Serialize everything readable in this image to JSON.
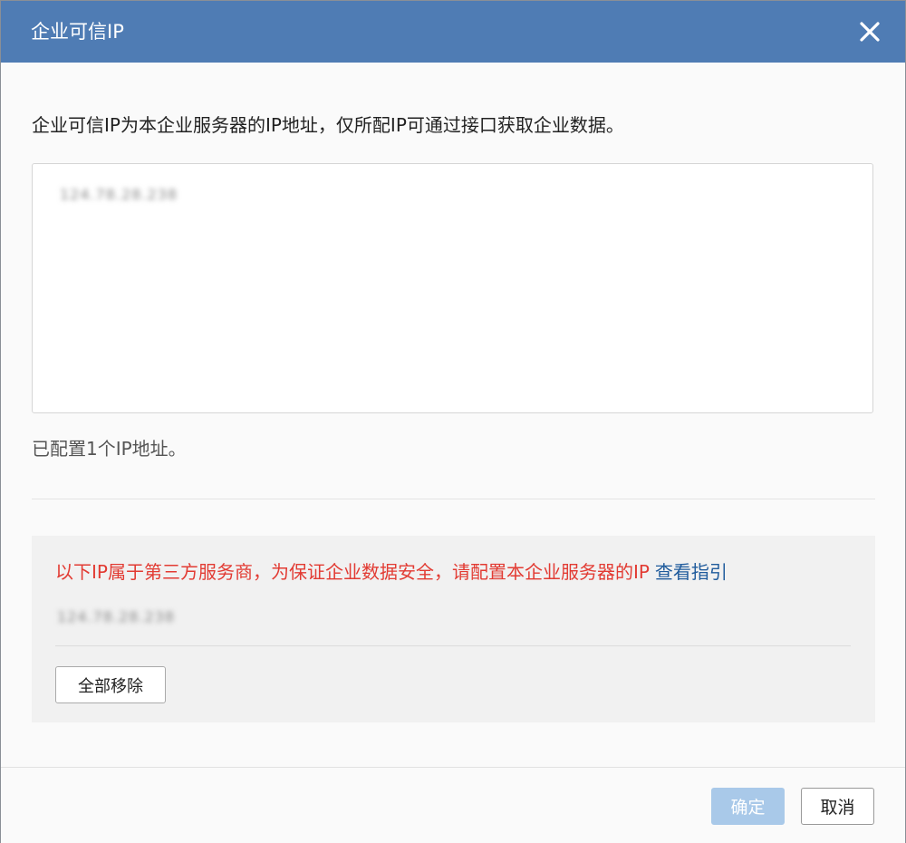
{
  "dialog": {
    "title": "企业可信IP",
    "close_icon": "close-icon"
  },
  "main": {
    "description": "企业可信IP为本企业服务器的IP地址，仅所配IP可通过接口获取企业数据。",
    "ip_list_value": "124.78.28.238",
    "configured_count_text": "已配置1个IP地址。"
  },
  "warning": {
    "text": "以下IP属于第三方服务商，为保证企业数据安全，请配置本企业服务器的IP",
    "link_label": "查看指引",
    "third_party_ip": "124.78.28.238",
    "remove_all_label": "全部移除",
    "text_color": "#e23b33",
    "link_color": "#1f5b9c"
  },
  "footer": {
    "ok_label": "确定",
    "cancel_label": "取消"
  },
  "colors": {
    "header_bg": "#4f7cb4",
    "ok_disabled_bg": "#a9c9e9"
  }
}
